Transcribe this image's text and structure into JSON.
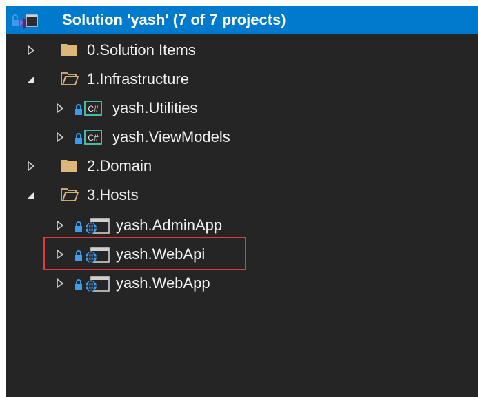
{
  "solution": {
    "label": "Solution 'yash' (7 of 7 projects)",
    "icon": "solution-icon"
  },
  "tree": [
    {
      "label": "0.Solution Items",
      "type": "folder",
      "state": "collapsed"
    },
    {
      "label": "1.Infrastructure",
      "type": "folder",
      "state": "expanded"
    },
    {
      "label": "yash.Utilities",
      "type": "csharp-project",
      "state": "collapsed"
    },
    {
      "label": "yash.ViewModels",
      "type": "csharp-project",
      "state": "collapsed"
    },
    {
      "label": "2.Domain",
      "type": "folder",
      "state": "collapsed"
    },
    {
      "label": "3.Hosts",
      "type": "folder",
      "state": "expanded"
    },
    {
      "label": "yash.AdminApp",
      "type": "web-project",
      "state": "collapsed"
    },
    {
      "label": "yash.WebApi",
      "type": "web-project",
      "state": "collapsed",
      "highlighted": true
    },
    {
      "label": "yash.WebApp",
      "type": "web-project",
      "state": "collapsed"
    }
  ],
  "colors": {
    "background": "#252526",
    "selection": "#007acc",
    "text": "#f1f1f1",
    "highlight_border": "#e03a3a",
    "lock": "#3d9be9",
    "csharp": "#4ec9b0",
    "folder": "#dcb67a"
  }
}
